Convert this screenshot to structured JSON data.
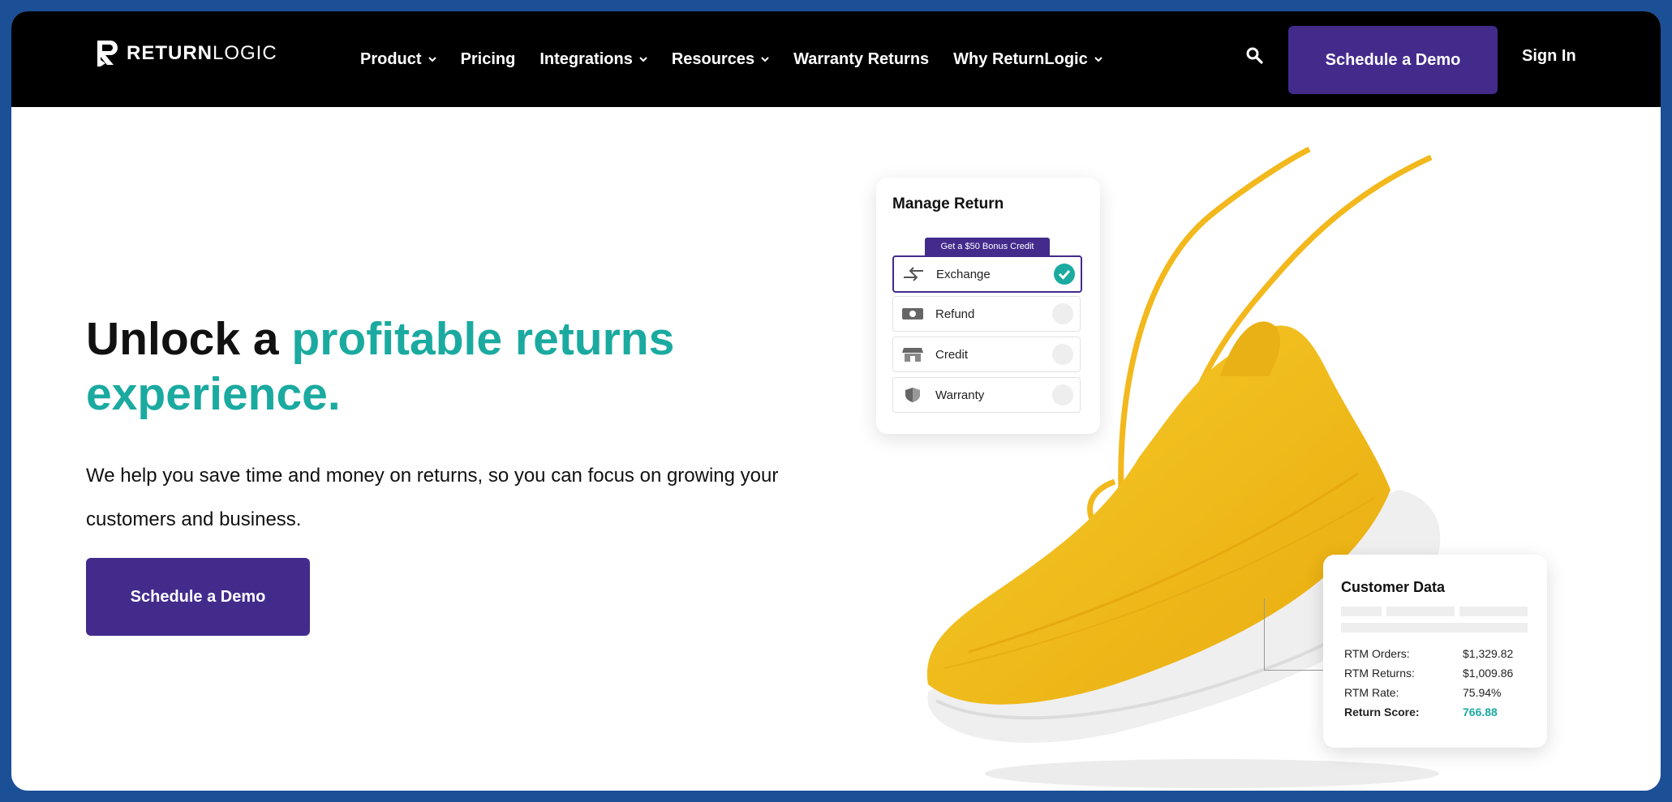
{
  "brand": {
    "name_bold": "RETURN",
    "name_light": "LOGIC"
  },
  "nav": {
    "items": [
      {
        "label": "Product",
        "dropdown": true
      },
      {
        "label": "Pricing",
        "dropdown": false
      },
      {
        "label": "Integrations",
        "dropdown": true
      },
      {
        "label": "Resources",
        "dropdown": true
      },
      {
        "label": "Warranty Returns",
        "dropdown": false
      },
      {
        "label": "Why ReturnLogic",
        "dropdown": true
      }
    ],
    "cta": "Schedule a Demo",
    "sign_in": "Sign In"
  },
  "hero": {
    "title_plain": "Unlock a ",
    "title_highlight": "profitable returns experience.",
    "subtitle": "We help you save time and money on returns, so you can focus on growing your customers and business.",
    "cta": "Schedule a Demo"
  },
  "manage_return": {
    "title": "Manage Return",
    "badge": "Get a $50 Bonus Credit",
    "options": [
      {
        "label": "Exchange",
        "icon": "exchange-arrows-icon",
        "selected": true
      },
      {
        "label": "Refund",
        "icon": "cash-icon",
        "selected": false
      },
      {
        "label": "Credit",
        "icon": "store-icon",
        "selected": false
      },
      {
        "label": "Warranty",
        "icon": "shield-icon",
        "selected": false
      }
    ]
  },
  "customer_data": {
    "title": "Customer Data",
    "rows": [
      {
        "label": "RTM Orders:",
        "value": "$1,329.82"
      },
      {
        "label": "RTM Returns:",
        "value": "$1,009.86"
      },
      {
        "label": "RTM Rate:",
        "value": "75.94%"
      },
      {
        "label": "Return Score:",
        "value": "766.88"
      }
    ]
  },
  "colors": {
    "nav_bg": "#000000",
    "primary": "#432b8c",
    "accent": "#1aaaa0",
    "frame": "#1b4f96",
    "shoe": "#f5c01e"
  }
}
